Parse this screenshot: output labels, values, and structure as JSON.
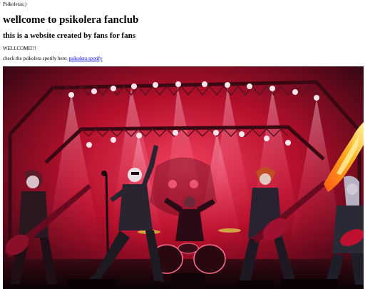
{
  "header": {
    "tab_text": "Psikoleras;)"
  },
  "main": {
    "title": "wellcome to psikolera fanclub",
    "subtitle": "this is a website created by fans for fans",
    "welcome": "WELLCOME!!!",
    "spotify_prefix": "check the psikolera spotify here: ",
    "spotify_link": "psikolera spotify"
  },
  "hero_image": {
    "description_icon": "band-concert-illustration",
    "colors": {
      "stage_red": "#c8102e",
      "dark": "#160408",
      "light": "#ffd6e0",
      "flame": "#ffb020"
    }
  }
}
